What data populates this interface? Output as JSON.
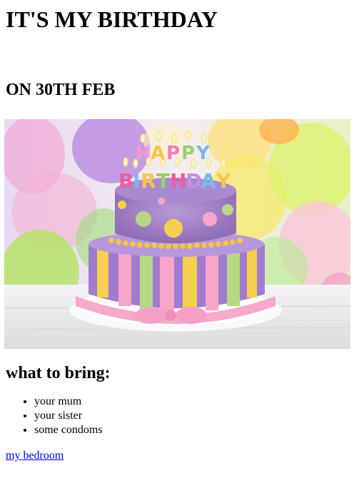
{
  "page": {
    "title": "IT'S MY BIRTHDAY",
    "date_heading": "ON 30TH FEB",
    "hero_image": {
      "topper_line1": "HAPPY",
      "topper_line2": "BIRTHDAY"
    },
    "bring_heading": "what to bring:",
    "bring_items": [
      "your mum",
      "your sister",
      "some condoms"
    ],
    "location_link": "my bedroom"
  },
  "colors": {
    "link": "#0000ee",
    "text": "#000000"
  }
}
